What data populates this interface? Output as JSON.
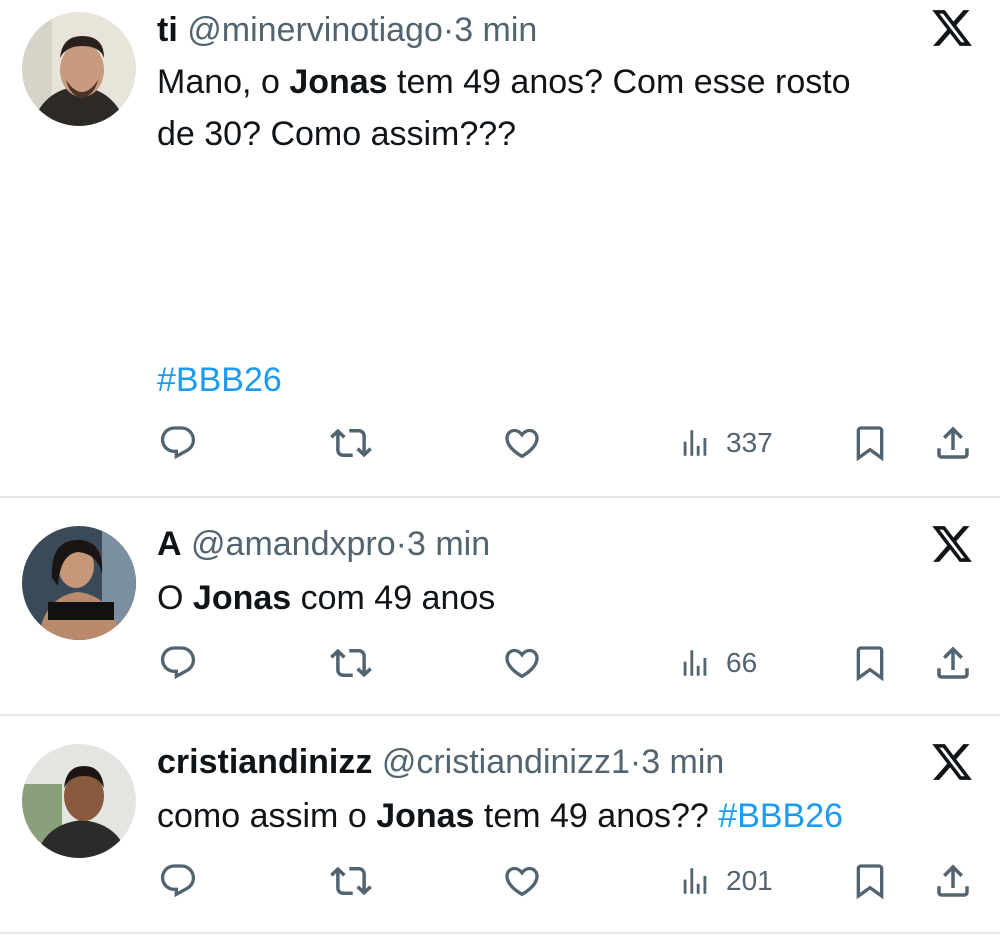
{
  "tweets": [
    {
      "name": "ti",
      "handle": "@minervinotiago",
      "separator": "·",
      "time": "3 min",
      "text_parts": [
        "Mano, o ",
        "Jonas",
        " tem 49 anos? Com esse rosto"
      ],
      "text_line2": "de 30? Como assim???",
      "hashtag": "#BBB26",
      "views": "337"
    },
    {
      "name": "A",
      "handle": "@amandxpro",
      "separator": "·",
      "time": "3 min",
      "text_parts": [
        "O ",
        "Jonas",
        " com 49 anos"
      ],
      "views": "66"
    },
    {
      "name": "cristiandinizz",
      "handle": "@cristiandinizz1",
      "separator": "·",
      "time": "3 min",
      "text_parts": [
        "como assim o ",
        "Jonas",
        " tem 49 anos?? "
      ],
      "hashtag": "#BBB26",
      "views": "201"
    }
  ],
  "icons": {
    "reply": "reply-icon",
    "retweet": "retweet-icon",
    "like": "heart-icon",
    "views": "views-icon",
    "bookmark": "bookmark-icon",
    "share": "share-icon",
    "brand": "x-logo-icon"
  },
  "colors": {
    "text": "#0f1419",
    "secondary": "#536471",
    "link": "#1d9bf0",
    "divider": "#e4e7ea"
  }
}
